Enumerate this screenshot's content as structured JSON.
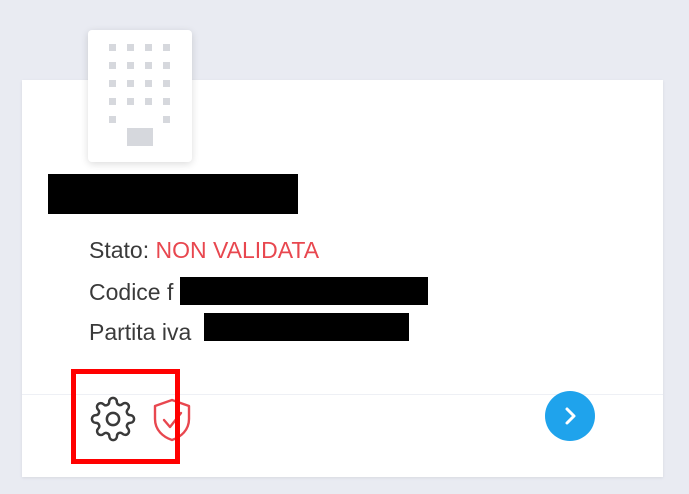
{
  "company_card": {
    "status_label": "Stato:",
    "status_value": "NON VALIDATA",
    "tax_code_label": "Codice f",
    "vat_label": "Partita iva",
    "status_color": "#e8474f",
    "accent_color": "#1fa3ec"
  },
  "icons": {
    "logo": "building-icon",
    "settings": "gear-icon",
    "validation": "shield-check-icon",
    "next": "chevron-right-icon"
  }
}
